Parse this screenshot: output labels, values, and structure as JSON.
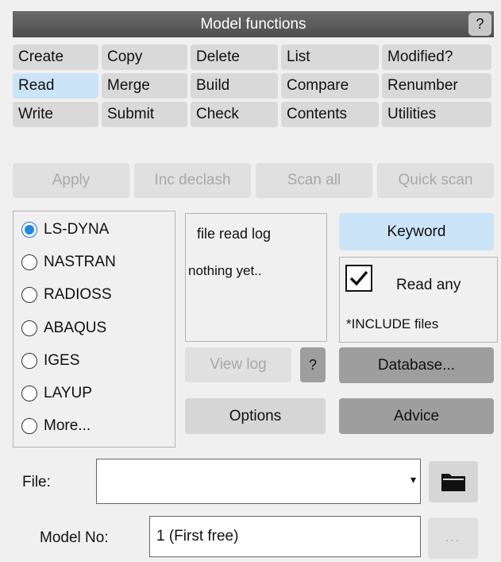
{
  "title": "Model functions",
  "help_label": "?",
  "functions": [
    [
      "Create",
      "Copy",
      "Delete",
      "List",
      "Modified?"
    ],
    [
      "Read",
      "Merge",
      "Build",
      "Compare",
      "Renumber"
    ],
    [
      "Write",
      "Submit",
      "Check",
      "Contents",
      "Utilities"
    ]
  ],
  "selected_function": "Read",
  "actions": {
    "apply": "Apply",
    "inc_declash": "Inc declash",
    "scan_all": "Scan all",
    "quick_scan": "Quick scan"
  },
  "formats": [
    "LS-DYNA",
    "NASTRAN",
    "RADIOSS",
    "ABAQUS",
    "IGES",
    "LAYUP",
    "More..."
  ],
  "selected_format": "LS-DYNA",
  "log": {
    "title": "file read log",
    "text": "nothing yet..",
    "view_log": "View log",
    "help": "?"
  },
  "options_label": "Options",
  "keyword_label": "Keyword",
  "read_any": {
    "checked": true,
    "label": "Read any",
    "sublabel": "*INCLUDE files"
  },
  "database_label": "Database...",
  "advice_label": "Advice",
  "file": {
    "label": "File:",
    "value": "",
    "arrow": "▾"
  },
  "model_no": {
    "label": "Model No:",
    "value": "1 (First free)",
    "more": "..."
  },
  "colors": {
    "selected": "#cce4f7",
    "radio_on": "#1e88e5",
    "title_bar": "#5a5a5a",
    "dark_button": "#9e9e9e"
  },
  "icons": {
    "folder": "folder-icon",
    "check": "checkmark-icon",
    "dropdown": "dropdown-arrow-icon"
  }
}
